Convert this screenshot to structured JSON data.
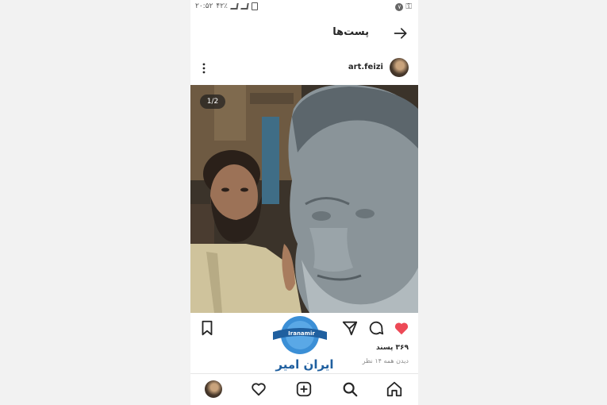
{
  "status_bar": {
    "time": "۲۰:۵۲",
    "battery_pct": "۴۲٪",
    "left_icons": [
      "signal-icon",
      "signal-icon",
      "battery-icon"
    ],
    "right_icons": [
      "notification-icon",
      "key-icon"
    ],
    "notification_badge": "۷"
  },
  "header": {
    "title": "پست‌ها",
    "back_icon": "arrow-right-icon"
  },
  "post": {
    "username": "art.feizi",
    "image_counter": "1/2",
    "likes": "۳۶۹ پسند",
    "views": "دیدن همه ۱۴ نظر",
    "liked": true,
    "like_color": "#ed4956"
  },
  "watermark": {
    "brand": "Iranamir",
    "text": "ایران امیر",
    "color": "#1f5f9f"
  },
  "bottom_nav": {
    "items": [
      "profile-avatar",
      "heart-icon",
      "add-post-icon",
      "search-icon",
      "home-icon"
    ]
  }
}
